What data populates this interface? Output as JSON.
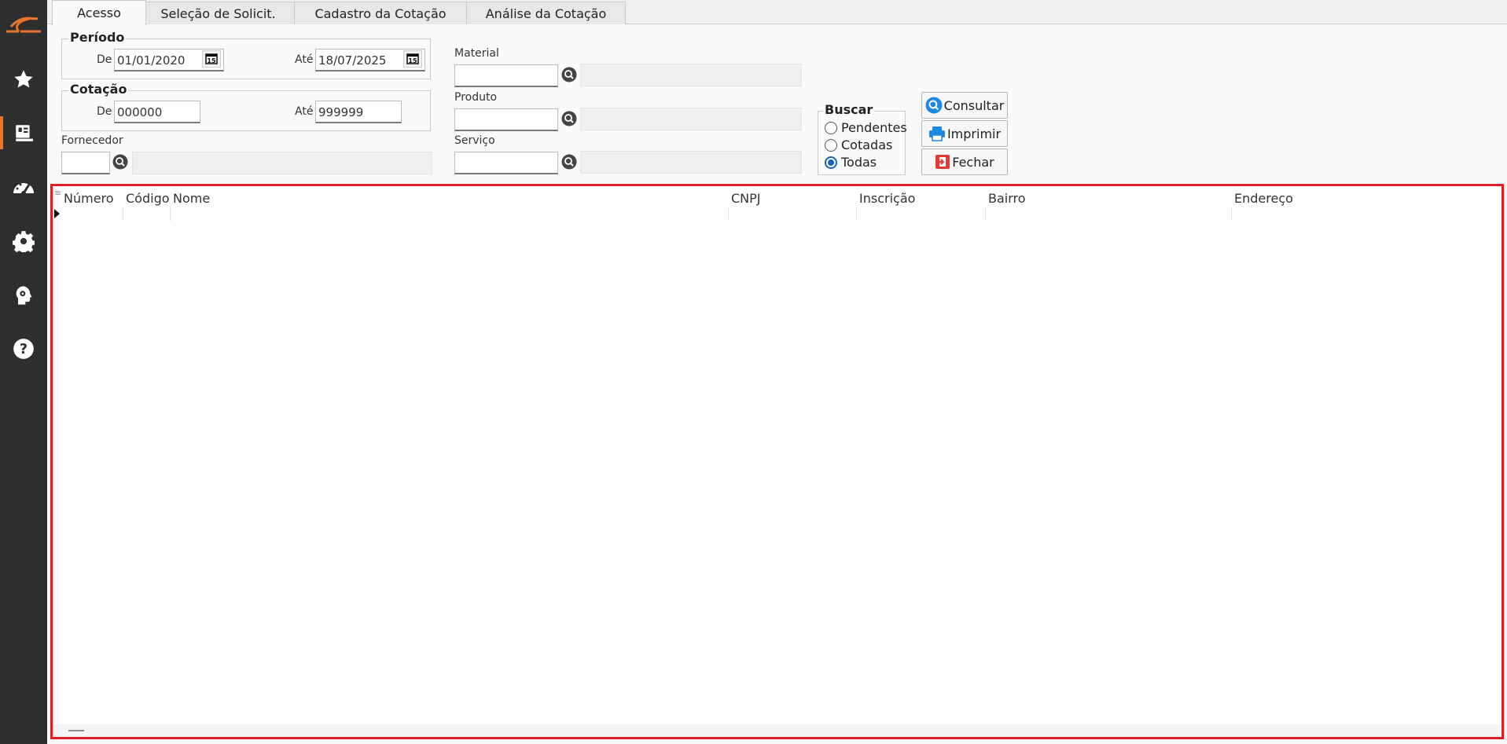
{
  "sidebar": {
    "logo": "company-logo",
    "items": [
      {
        "icon": "star-icon",
        "name": "favorites"
      },
      {
        "icon": "ledger-icon",
        "name": "modules",
        "active": true
      },
      {
        "icon": "gauge-icon",
        "name": "dashboard"
      },
      {
        "icon": "gear-icon",
        "name": "settings"
      },
      {
        "icon": "head-gear-icon",
        "name": "intelligence"
      },
      {
        "icon": "help-icon",
        "name": "help"
      }
    ]
  },
  "tabs": [
    {
      "label": "Acesso",
      "active": true
    },
    {
      "label": "Seleção de Solicit."
    },
    {
      "label": "Cadastro da Cotação"
    },
    {
      "label": "Análise da Cotação"
    }
  ],
  "periodo": {
    "title": "Período",
    "from_label": "De",
    "from_value": "01/01/2020",
    "to_label": "Até",
    "to_value": "18/07/2025"
  },
  "cotacao": {
    "title": "Cotação",
    "from_label": "De",
    "from_value": "000000",
    "to_label": "Até",
    "to_value": "999999"
  },
  "fornecedor": {
    "label": "Fornecedor",
    "value": ""
  },
  "material": {
    "label": "Material",
    "value": ""
  },
  "produto": {
    "label": "Produto",
    "value": ""
  },
  "servico": {
    "label": "Serviço",
    "value": ""
  },
  "buscar": {
    "title": "Buscar",
    "options": [
      {
        "label": "Pendentes",
        "selected": false
      },
      {
        "label": "Cotadas",
        "selected": false
      },
      {
        "label": "Todas",
        "selected": true
      }
    ]
  },
  "buttons": {
    "consultar": "Consultar",
    "imprimir": "Imprimir",
    "fechar": "Fechar"
  },
  "grid": {
    "columns": [
      "Número",
      "Código",
      "Nome",
      "CNPJ",
      "Inscrição",
      "Bairro",
      "Endereço"
    ]
  },
  "colors": {
    "accent": "#e8742c",
    "highlight": "#e01e26",
    "sidebar_bg": "#2e2e2e",
    "radio_selected": "#1565c0"
  }
}
